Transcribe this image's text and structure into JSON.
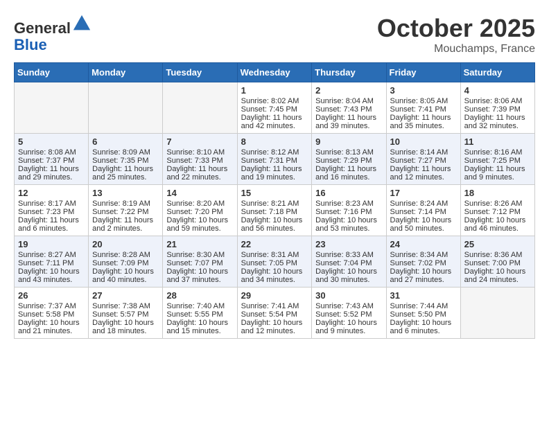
{
  "header": {
    "logo_line1": "General",
    "logo_line2": "Blue",
    "month": "October 2025",
    "location": "Mouchamps, France"
  },
  "weekdays": [
    "Sunday",
    "Monday",
    "Tuesday",
    "Wednesday",
    "Thursday",
    "Friday",
    "Saturday"
  ],
  "weeks": [
    [
      {
        "day": "",
        "info": ""
      },
      {
        "day": "",
        "info": ""
      },
      {
        "day": "",
        "info": ""
      },
      {
        "day": "1",
        "info": "Sunrise: 8:02 AM\nSunset: 7:45 PM\nDaylight: 11 hours and 42 minutes."
      },
      {
        "day": "2",
        "info": "Sunrise: 8:04 AM\nSunset: 7:43 PM\nDaylight: 11 hours and 39 minutes."
      },
      {
        "day": "3",
        "info": "Sunrise: 8:05 AM\nSunset: 7:41 PM\nDaylight: 11 hours and 35 minutes."
      },
      {
        "day": "4",
        "info": "Sunrise: 8:06 AM\nSunset: 7:39 PM\nDaylight: 11 hours and 32 minutes."
      }
    ],
    [
      {
        "day": "5",
        "info": "Sunrise: 8:08 AM\nSunset: 7:37 PM\nDaylight: 11 hours and 29 minutes."
      },
      {
        "day": "6",
        "info": "Sunrise: 8:09 AM\nSunset: 7:35 PM\nDaylight: 11 hours and 25 minutes."
      },
      {
        "day": "7",
        "info": "Sunrise: 8:10 AM\nSunset: 7:33 PM\nDaylight: 11 hours and 22 minutes."
      },
      {
        "day": "8",
        "info": "Sunrise: 8:12 AM\nSunset: 7:31 PM\nDaylight: 11 hours and 19 minutes."
      },
      {
        "day": "9",
        "info": "Sunrise: 8:13 AM\nSunset: 7:29 PM\nDaylight: 11 hours and 16 minutes."
      },
      {
        "day": "10",
        "info": "Sunrise: 8:14 AM\nSunset: 7:27 PM\nDaylight: 11 hours and 12 minutes."
      },
      {
        "day": "11",
        "info": "Sunrise: 8:16 AM\nSunset: 7:25 PM\nDaylight: 11 hours and 9 minutes."
      }
    ],
    [
      {
        "day": "12",
        "info": "Sunrise: 8:17 AM\nSunset: 7:23 PM\nDaylight: 11 hours and 6 minutes."
      },
      {
        "day": "13",
        "info": "Sunrise: 8:19 AM\nSunset: 7:22 PM\nDaylight: 11 hours and 2 minutes."
      },
      {
        "day": "14",
        "info": "Sunrise: 8:20 AM\nSunset: 7:20 PM\nDaylight: 10 hours and 59 minutes."
      },
      {
        "day": "15",
        "info": "Sunrise: 8:21 AM\nSunset: 7:18 PM\nDaylight: 10 hours and 56 minutes."
      },
      {
        "day": "16",
        "info": "Sunrise: 8:23 AM\nSunset: 7:16 PM\nDaylight: 10 hours and 53 minutes."
      },
      {
        "day": "17",
        "info": "Sunrise: 8:24 AM\nSunset: 7:14 PM\nDaylight: 10 hours and 50 minutes."
      },
      {
        "day": "18",
        "info": "Sunrise: 8:26 AM\nSunset: 7:12 PM\nDaylight: 10 hours and 46 minutes."
      }
    ],
    [
      {
        "day": "19",
        "info": "Sunrise: 8:27 AM\nSunset: 7:11 PM\nDaylight: 10 hours and 43 minutes."
      },
      {
        "day": "20",
        "info": "Sunrise: 8:28 AM\nSunset: 7:09 PM\nDaylight: 10 hours and 40 minutes."
      },
      {
        "day": "21",
        "info": "Sunrise: 8:30 AM\nSunset: 7:07 PM\nDaylight: 10 hours and 37 minutes."
      },
      {
        "day": "22",
        "info": "Sunrise: 8:31 AM\nSunset: 7:05 PM\nDaylight: 10 hours and 34 minutes."
      },
      {
        "day": "23",
        "info": "Sunrise: 8:33 AM\nSunset: 7:04 PM\nDaylight: 10 hours and 30 minutes."
      },
      {
        "day": "24",
        "info": "Sunrise: 8:34 AM\nSunset: 7:02 PM\nDaylight: 10 hours and 27 minutes."
      },
      {
        "day": "25",
        "info": "Sunrise: 8:36 AM\nSunset: 7:00 PM\nDaylight: 10 hours and 24 minutes."
      }
    ],
    [
      {
        "day": "26",
        "info": "Sunrise: 7:37 AM\nSunset: 5:58 PM\nDaylight: 10 hours and 21 minutes."
      },
      {
        "day": "27",
        "info": "Sunrise: 7:38 AM\nSunset: 5:57 PM\nDaylight: 10 hours and 18 minutes."
      },
      {
        "day": "28",
        "info": "Sunrise: 7:40 AM\nSunset: 5:55 PM\nDaylight: 10 hours and 15 minutes."
      },
      {
        "day": "29",
        "info": "Sunrise: 7:41 AM\nSunset: 5:54 PM\nDaylight: 10 hours and 12 minutes."
      },
      {
        "day": "30",
        "info": "Sunrise: 7:43 AM\nSunset: 5:52 PM\nDaylight: 10 hours and 9 minutes."
      },
      {
        "day": "31",
        "info": "Sunrise: 7:44 AM\nSunset: 5:50 PM\nDaylight: 10 hours and 6 minutes."
      },
      {
        "day": "",
        "info": ""
      }
    ]
  ]
}
